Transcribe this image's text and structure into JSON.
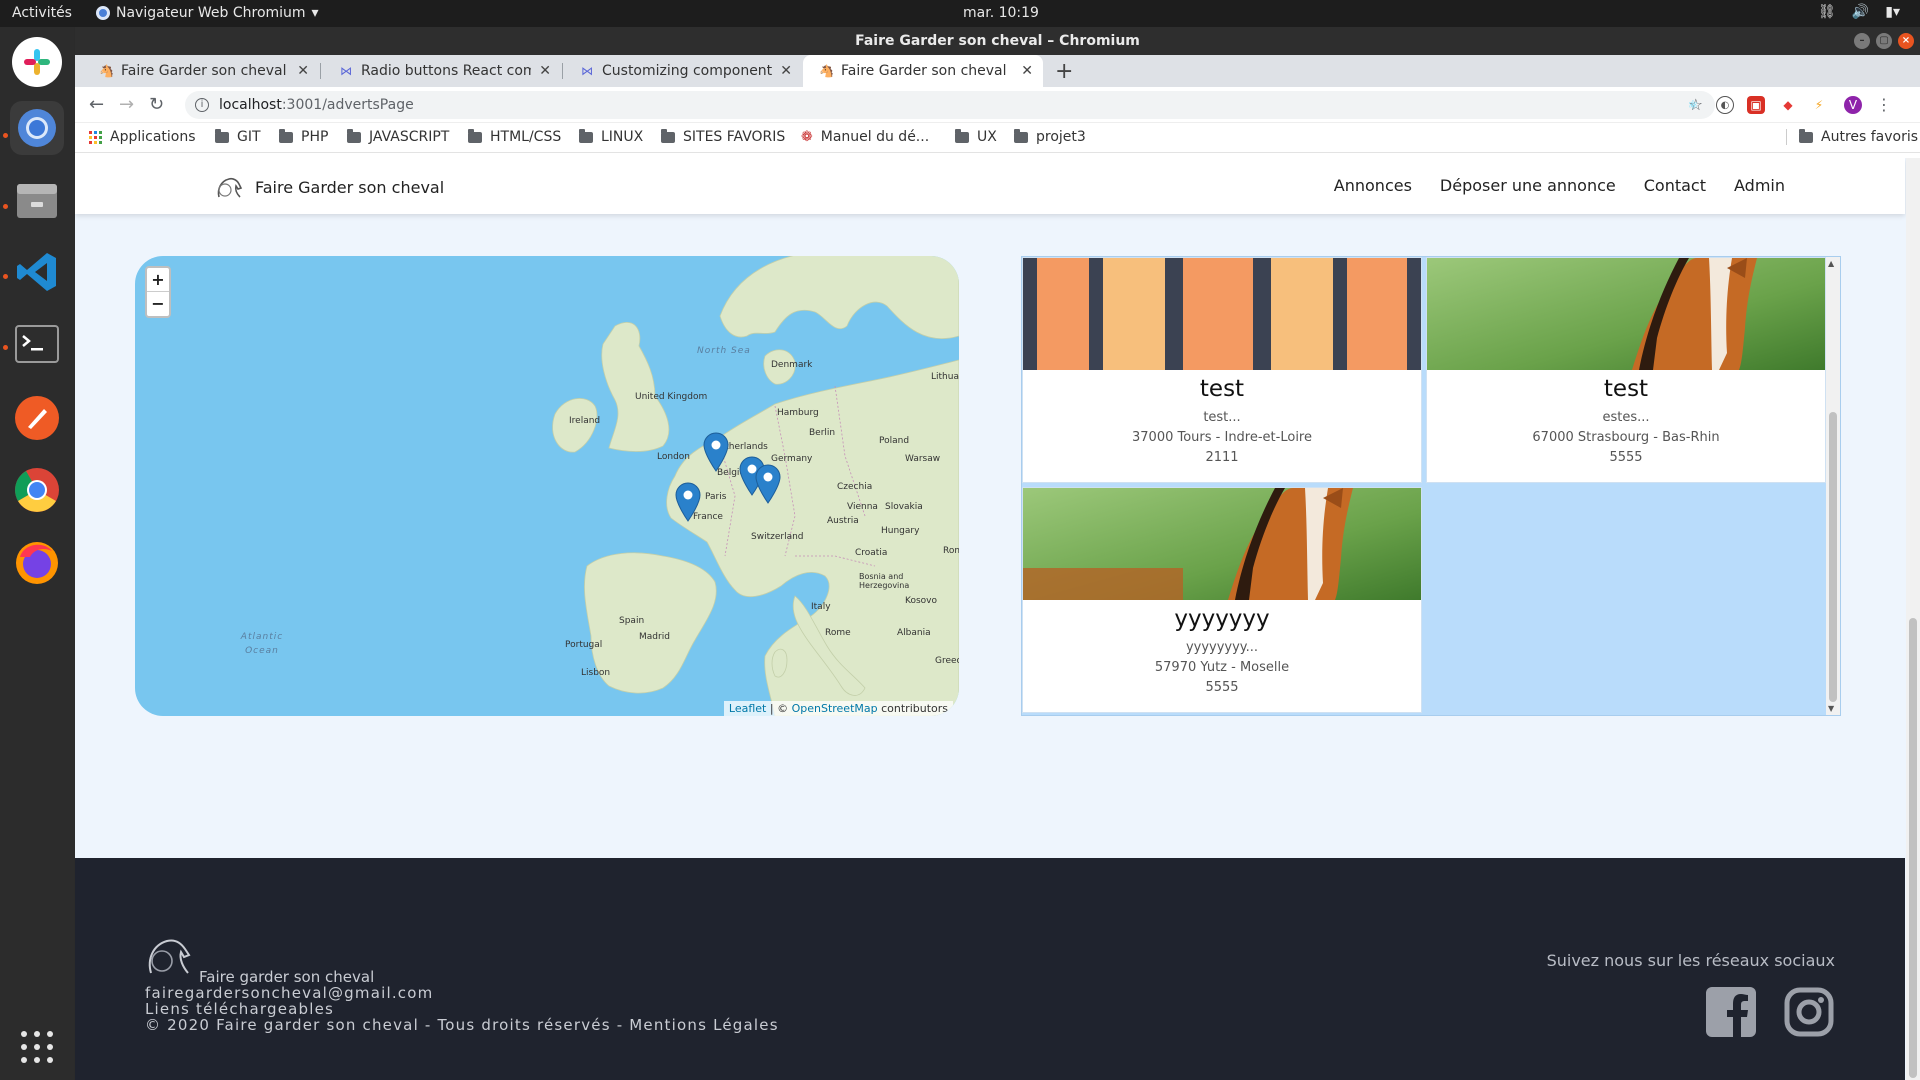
{
  "os": {
    "activities": "Activités",
    "app_menu": "Navigateur Web Chromium",
    "clock": "mar. 10:19"
  },
  "window": {
    "title": "Faire Garder son cheval – Chromium"
  },
  "tabs": [
    {
      "label": "Faire Garder son cheval",
      "active": false
    },
    {
      "label": "Radio buttons React comp",
      "active": false
    },
    {
      "label": "Customizing components",
      "active": false
    },
    {
      "label": "Faire Garder son cheval",
      "active": true
    }
  ],
  "address_bar": {
    "host": "localhost",
    "path": ":3001/advertsPage"
  },
  "bookmarks": {
    "applications": "Applications",
    "items": [
      "GIT",
      "PHP",
      "JAVASCRIPT",
      "HTML/CSS",
      "LINUX",
      "SITES FAVORIS",
      "Manuel du dé...",
      "UX",
      "projet3"
    ],
    "other": "Autres favoris"
  },
  "profile_initial": "V",
  "site": {
    "brand": "Faire Garder son cheval",
    "nav": [
      "Annonces",
      "Déposer une annonce",
      "Contact",
      "Admin"
    ]
  },
  "map": {
    "zoom_in": "+",
    "zoom_out": "−",
    "attribution_leaflet": "Leaflet",
    "attribution_sep": " | © ",
    "attribution_osm": "OpenStreetMap",
    "attribution_rest": " contributors",
    "labels": {
      "north_sea": "North Sea",
      "denmark": "Denmark",
      "uk": "United Kingdom",
      "ireland": "Ireland",
      "netherlands": "Netherlands",
      "belgium": "Belgium",
      "germany": "Germany",
      "poland": "Poland",
      "lithuania": "Lithuani",
      "france": "France",
      "switzerland": "Switzerland",
      "austria": "Austria",
      "czechia": "Czechia",
      "hungary": "Hungary",
      "slovakia": "Slovakia",
      "croatia": "Croatia",
      "bosnia": "Bosnia and Herzegovina",
      "romania": "Rom",
      "italy": "Italy",
      "spain": "Spain",
      "portugal": "Portugal",
      "albania": "Albania",
      "greece": "Greece",
      "kosovo": "Kosovo",
      "atlantic": "Atlantic Ocean",
      "london": "London",
      "paris": "Paris",
      "berlin": "Berlin",
      "hamburg": "Hamburg",
      "warsaw": "Warsaw",
      "vienna": "Vienna",
      "rome": "Rome",
      "madrid": "Madrid",
      "lisbon": "Lisbon"
    }
  },
  "adverts": [
    {
      "title": "test",
      "desc": "test...",
      "location": "37000 Tours - Indre-et-Loire",
      "price": "2111",
      "image": "striped-pattern"
    },
    {
      "title": "test",
      "desc": "estes...",
      "location": "67000 Strasbourg - Bas-Rhin",
      "price": "5555",
      "image": "horse-photo"
    },
    {
      "title": "yyyyyyy",
      "desc": "yyyyyyyy...",
      "location": "57970 Yutz - Moselle",
      "price": "5555",
      "image": "horse-photo"
    }
  ],
  "footer": {
    "name": "Faire garder son cheval",
    "email": "fairegardersoncheval@gmail.com",
    "downloads": "Liens téléchargeables",
    "copyright": "© 2020 Faire garder son cheval - Tous droits réservés - Mentions Légales",
    "follow": "Suivez nous sur les réseaux sociaux"
  },
  "colors": {
    "footer_bg": "#1f232e",
    "page_bg": "#eef5fd",
    "panel_bg": "#b9dcfb",
    "marker": "#2a81cb",
    "ubuntu_accent": "#e95420"
  }
}
